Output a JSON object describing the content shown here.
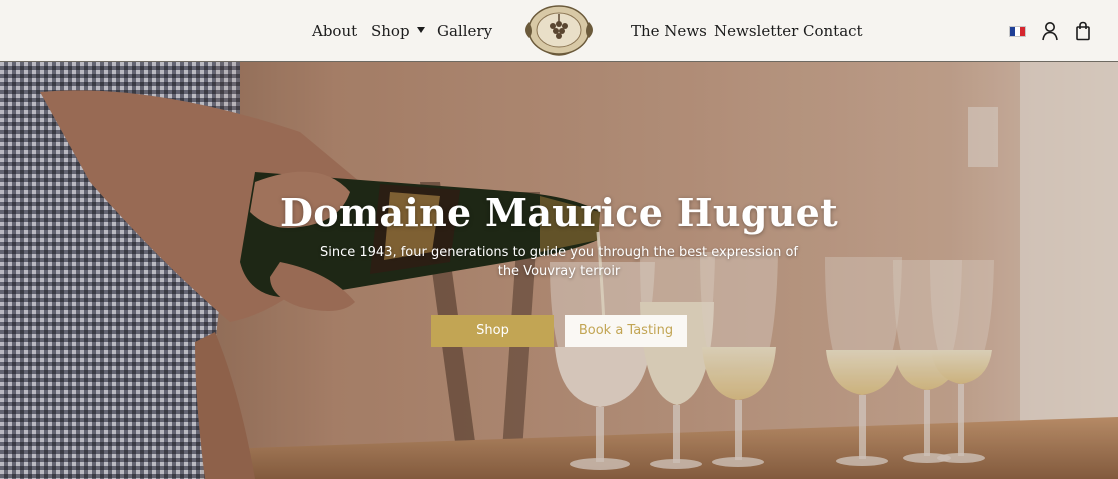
{
  "nav": {
    "about": "About",
    "shop": "Shop",
    "gallery": "Gallery",
    "news": "The News",
    "newsletter": "Newsletter",
    "contact": "Contact"
  },
  "header_icons": {
    "flag": "france-flag-icon",
    "account": "user-icon",
    "cart": "shopping-bag-icon"
  },
  "hero": {
    "title": "Domaine Maurice Huguet",
    "subtitle": "Since 1943, four generations to guide you through the best expression of the Vouvray terroir",
    "shop_button": "Shop",
    "tasting_button": "Book a Tasting"
  },
  "colors": {
    "accent_gold": "#c2a554",
    "header_bg": "#f6f4f0",
    "flag_blue": "#1f3f96",
    "flag_white": "#ffffff",
    "flag_red": "#d5262e"
  }
}
